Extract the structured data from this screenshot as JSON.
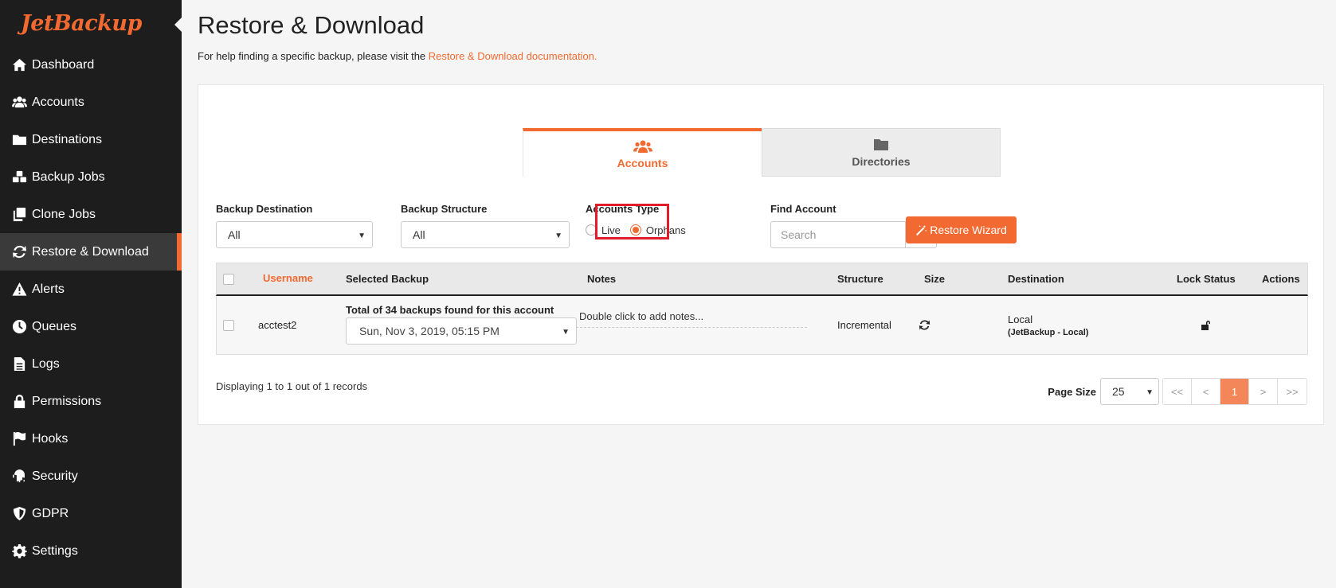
{
  "brand": {
    "logo_text": "JetBackup",
    "accent_color": "#f26a31"
  },
  "sidebar": {
    "items": [
      {
        "label": "Dashboard",
        "icon": "home-icon",
        "active": false
      },
      {
        "label": "Accounts",
        "icon": "users-icon",
        "active": false
      },
      {
        "label": "Destinations",
        "icon": "folder-icon",
        "active": false
      },
      {
        "label": "Backup Jobs",
        "icon": "cubes-icon",
        "active": false
      },
      {
        "label": "Clone Jobs",
        "icon": "clone-icon",
        "active": false
      },
      {
        "label": "Restore & Download",
        "icon": "refresh-icon",
        "active": true
      },
      {
        "label": "Alerts",
        "icon": "warning-icon",
        "active": false
      },
      {
        "label": "Queues",
        "icon": "clock-icon",
        "active": false
      },
      {
        "label": "Logs",
        "icon": "file-icon",
        "active": false
      },
      {
        "label": "Permissions",
        "icon": "lock-icon",
        "active": false
      },
      {
        "label": "Hooks",
        "icon": "flag-icon",
        "active": false
      },
      {
        "label": "Security",
        "icon": "fingerprint-icon",
        "active": false
      },
      {
        "label": "GDPR",
        "icon": "shield-icon",
        "active": false
      },
      {
        "label": "Settings",
        "icon": "gear-icon",
        "active": false
      }
    ]
  },
  "header": {
    "title": "Restore & Download",
    "help_prefix": "For help finding a specific backup, please visit the ",
    "help_link": "Restore & Download documentation."
  },
  "tabs": [
    {
      "label": "Accounts",
      "icon": "users-icon",
      "active": true
    },
    {
      "label": "Directories",
      "icon": "folder-icon",
      "active": false
    }
  ],
  "filters": {
    "backup_destination": {
      "label": "Backup Destination",
      "value": "All"
    },
    "backup_structure": {
      "label": "Backup Structure",
      "value": "All"
    },
    "accounts_type": {
      "label": "Accounts Type",
      "options": [
        "Live",
        "Orphans"
      ],
      "selected": "Orphans"
    },
    "find_account": {
      "label": "Find Account",
      "placeholder": "Search"
    },
    "restore_wizard_label": "Restore Wizard"
  },
  "table": {
    "headers": [
      "Username",
      "Selected Backup",
      "Notes",
      "Structure",
      "Size",
      "Destination",
      "Lock Status",
      "Actions"
    ],
    "rows": [
      {
        "username": "acctest2",
        "backup_count": "Total of 34 backups found for this account",
        "selected_backup": "Sun, Nov 3, 2019, 05:15 PM",
        "notes": "Double click to add notes...",
        "structure": "Incremental",
        "size_icon": "refresh-icon",
        "destination": "Local",
        "destination_detail": "(JetBackup - Local)",
        "lock_icon": "unlock-icon"
      }
    ]
  },
  "footer": {
    "records_text": "Displaying 1 to 1 out of 1 records",
    "page_size_label": "Page Size",
    "page_size": "25",
    "pager": [
      "<<",
      "<",
      "1",
      ">",
      ">>"
    ],
    "current_page": "1"
  }
}
